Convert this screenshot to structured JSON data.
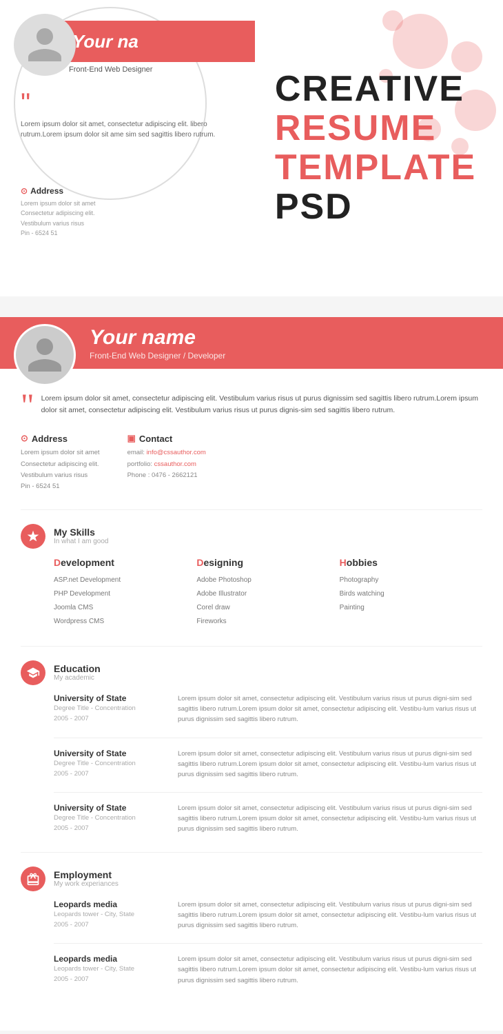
{
  "preview": {
    "name": "Your na",
    "title": "Front-End Web Designer",
    "quote": "Lorem ipsum dolor sit amet, consectetur adipiscing elit. Vestibulum varius risus ut purus dignissim sed sagittis libero rutrum.Lorem ipsum dolor sit amet, consectetur adipiscing elit. Vestibulum varius risus ut purus dignissim sed sagittis libero rutrum.",
    "quote_short": "Lorem ipsum dolor sit amet, consectetur adipiscing elit. libero rutrum.Lorem ipsum dolor sit ame sim sed sagittis libero rutrum.",
    "address_label": "Address",
    "address_text": "Lorem ipsum dolor sit amet\nConsectetur adipiscing elit.\nVestibulum varius risus\nPin - 6524 51"
  },
  "title_block": {
    "line1": "CREATIVE",
    "line2": "RESUME",
    "line3": "TEMPLATE",
    "line4": "PSD"
  },
  "resume": {
    "name": "Your name",
    "subtitle": "Front-End Web Designer / Developer",
    "quote": "Lorem ipsum dolor sit amet, consectetur adipiscing elit. Vestibulum varius risus ut purus dignissim sed sagittis libero rutrum.Lorem ipsum dolor sit amet, consectetur adipiscing elit. Vestibulum varius risus ut purus dignis-sim sed sagittis libero rutrum.",
    "address": {
      "label": "Address",
      "lines": "Lorem ipsum dolor sit amet\nConsectetur adipiscing elit.\nVestibulum varius risus\nPin - 6524 51"
    },
    "contact": {
      "label": "Contact",
      "email_label": "email:",
      "email": "info@cssauthor.com",
      "portfolio_label": "portfolio:",
      "portfolio": "cssauthor.com",
      "phone_label": "Phone :",
      "phone": "0476 - 2662121"
    },
    "skills": {
      "section_title": "My Skills",
      "section_sub": "In what I am good",
      "columns": [
        {
          "heading": "Development",
          "heading_first": "D",
          "items": [
            "ASP.net Development",
            "PHP Development",
            "Joomla CMS",
            "Wordpress CMS"
          ]
        },
        {
          "heading": "Designing",
          "heading_first": "D",
          "items": [
            "Adobe Photoshop",
            "Adobe Illustrator",
            "Corel draw",
            "Fireworks"
          ]
        },
        {
          "heading": "Hobbies",
          "heading_first": "H",
          "items": [
            "Photography",
            "Birds watching",
            "Painting"
          ]
        }
      ]
    },
    "education": {
      "section_title": "Education",
      "section_sub": "My academic",
      "entries": [
        {
          "school": "University of State",
          "detail": "Degree Title - Concentration\n2005 - 2007",
          "desc": "Lorem ipsum dolor sit amet, consectetur adipiscing elit. Vestibulum varius risus ut purus digni-sim sed sagittis libero rutrum.Lorem ipsum dolor sit amet, consectetur adipiscing elit. Vestibu-lum varius risus ut purus dignissim sed sagittis libero rutrum."
        },
        {
          "school": "University of State",
          "detail": "Degree Title - Concentration\n2005 - 2007",
          "desc": "Lorem ipsum dolor sit amet, consectetur adipiscing elit. Vestibulum varius risus ut purus digni-sim sed sagittis libero rutrum.Lorem ipsum dolor sit amet, consectetur adipiscing elit. Vestibu-lum varius risus ut purus dignissim sed sagittis libero rutrum."
        },
        {
          "school": "University of State",
          "detail": "Degree Title - Concentration\n2005 - 2007",
          "desc": "Lorem ipsum dolor sit amet, consectetur adipiscing elit. Vestibulum varius risus ut purus digni-sim sed sagittis libero rutrum.Lorem ipsum dolor sit amet, consectetur adipiscing elit. Vestibu-lum varius risus ut purus dignissim sed sagittis libero rutrum."
        }
      ]
    },
    "employment": {
      "section_title": "Employment",
      "section_sub": "My work experiances",
      "entries": [
        {
          "company": "Leopards media",
          "detail": "Leopards tower - City, State\n2005 - 2007",
          "desc": "Lorem ipsum dolor sit amet, consectetur adipiscing elit. Vestibulum varius risus ut purus digni-sim sed sagittis libero rutrum.Lorem ipsum dolor sit amet, consectetur adipiscing elit. Vestibu-lum varius risus ut purus dignissim sed sagittis libero rutrum."
        },
        {
          "company": "Leopards media",
          "detail": "Leopards tower - City, State\n2005 - 2007",
          "desc": "Lorem ipsum dolor sit amet, consectetur adipiscing elit. Vestibulum varius risus ut purus digni-sim sed sagittis libero rutrum.Lorem ipsum dolor sit amet, consectetur adipiscing elit. Vestibu-lum varius risus ut purus dignissim sed sagittis libero rutrum."
        }
      ]
    }
  }
}
